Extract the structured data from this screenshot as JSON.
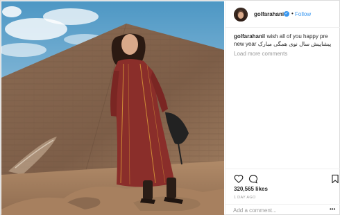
{
  "post": {
    "username": "golfarahani",
    "verified_icon": "verified-badge-icon",
    "separator": "•",
    "follow_label": "Follow",
    "caption_user": "golfarahani",
    "caption_text": "I wish all of you happy pre new year پیشاپیش سال نوی همگی مبارک",
    "load_more": "Load more comments",
    "likes": "320,565 likes",
    "date": "1 DAY AGO",
    "comment_placeholder": "Add a comment...",
    "more_label": "•••"
  },
  "colors": {
    "link": "#3897f0",
    "text": "#262626",
    "muted": "#999999",
    "divider": "#efefef"
  },
  "icons": [
    "heart-icon",
    "comment-icon",
    "bookmark-icon",
    "verified-badge-icon"
  ]
}
